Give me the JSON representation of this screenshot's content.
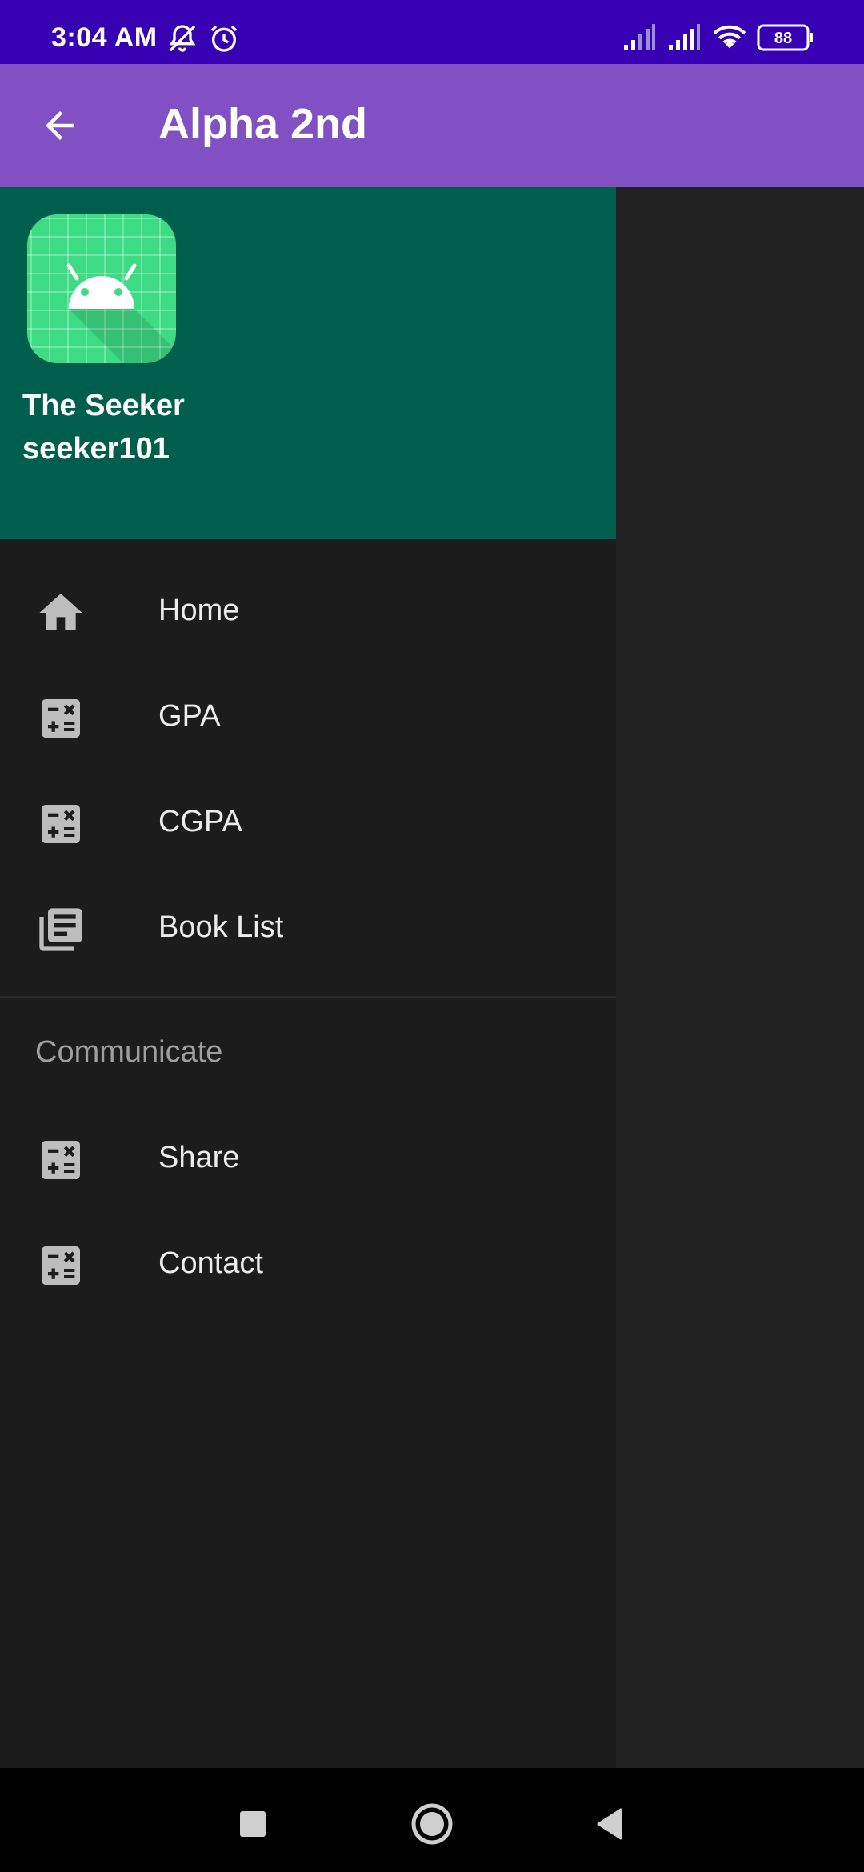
{
  "status_bar": {
    "time": "3:04 AM",
    "battery": "88",
    "icons": [
      "mute-icon",
      "alarm-icon",
      "signal-icon",
      "signal-icon",
      "wifi-icon",
      "battery-icon"
    ]
  },
  "app_bar": {
    "title": "Alpha 2nd",
    "back_icon": "arrow-back-icon"
  },
  "drawer": {
    "header": {
      "name": "The Seeker",
      "username": "seeker101",
      "avatar_icon": "android-icon"
    },
    "items": [
      {
        "label": "Home",
        "icon": "home-icon"
      },
      {
        "label": "GPA",
        "icon": "calculate-icon"
      },
      {
        "label": "CGPA",
        "icon": "calculate-icon"
      },
      {
        "label": "Book List",
        "icon": "library-books-icon"
      }
    ],
    "section_title": "Communicate",
    "section_items": [
      {
        "label": "Share",
        "icon": "calculate-icon"
      },
      {
        "label": "Contact",
        "icon": "calculate-icon"
      }
    ]
  },
  "nav_bar": {
    "icons": [
      "recents-square-icon",
      "home-circle-icon",
      "back-triangle-icon"
    ]
  },
  "colors": {
    "status_bar": "#3700b3",
    "app_bar": "#8150c3",
    "drawer_header": "#005e4d",
    "drawer_bg": "#1c1c1c",
    "avatar_bg": "#3ddc84"
  }
}
